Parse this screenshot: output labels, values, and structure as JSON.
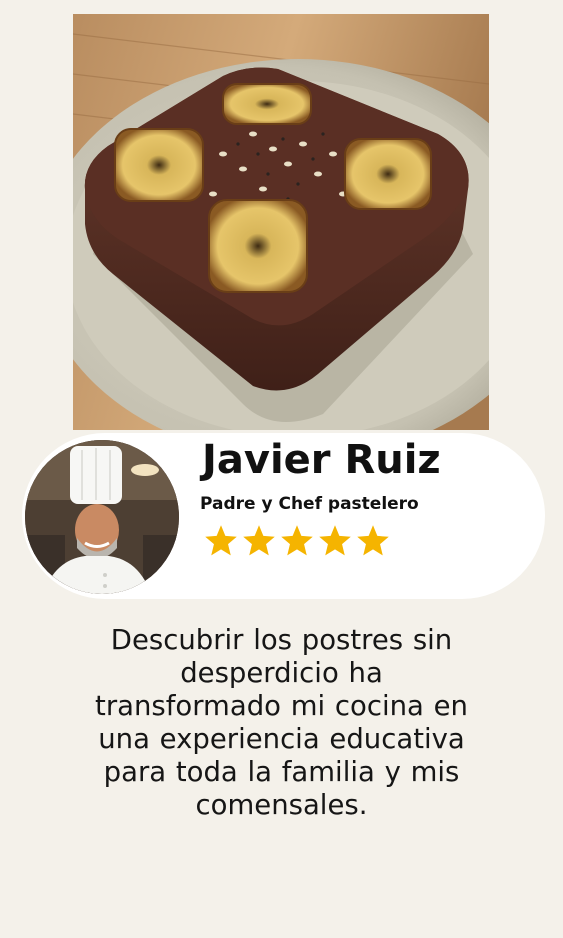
{
  "hero_image": {
    "description_icon": "brownie-photo"
  },
  "profile": {
    "name": "Javier Ruiz",
    "subtitle": "Padre y Chef pastelero",
    "rating": 5,
    "rating_max": 5,
    "star_color": "#f5b400",
    "avatar_icon": "chef-avatar"
  },
  "testimonial": {
    "text": "Descubrir los postres sin\ndesperdicio ha\ntransformado mi cocina  en\nuna experiencia  educativa\npara toda la familia y mis\ncomensales."
  }
}
